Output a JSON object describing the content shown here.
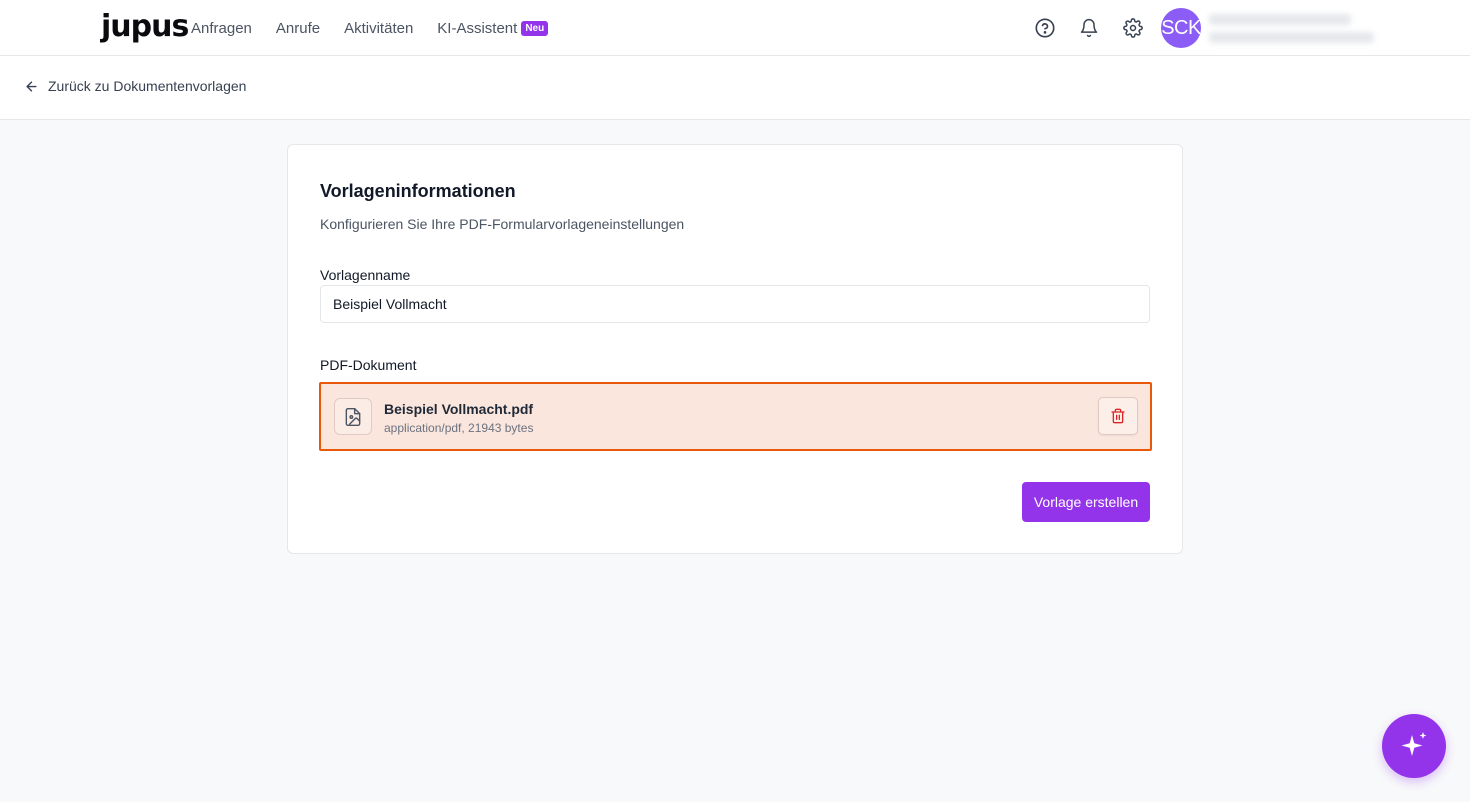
{
  "app": {
    "logo_text": "jupus"
  },
  "nav": {
    "items": [
      {
        "label": "Anfragen"
      },
      {
        "label": "Anrufe"
      },
      {
        "label": "Aktivitäten"
      },
      {
        "label": "KI-Assistent",
        "badge": "Neu"
      }
    ]
  },
  "header_icons": [
    "help-circle-icon",
    "bell-icon",
    "gear-icon"
  ],
  "user": {
    "initials": "SCK"
  },
  "back": {
    "label": "Zurück zu Dokumentenvorlagen"
  },
  "form": {
    "title": "Vorlageninformationen",
    "subtitle": "Konfigurieren Sie Ihre PDF-Formularvorlageneinstellungen",
    "name_label": "Vorlagenname",
    "name_value": "Beispiel Vollmacht",
    "pdf_label": "PDF-Dokument",
    "file": {
      "name": "Beispiel Vollmacht.pdf",
      "meta": "application/pdf, 21943 bytes"
    },
    "submit_label": "Vorlage erstellen"
  },
  "colors": {
    "accent": "#9333ea",
    "file_border": "#ea580c",
    "file_background": "#fbe6de",
    "delete_icon": "#dc2626",
    "avatar": "#8b5cf6"
  }
}
